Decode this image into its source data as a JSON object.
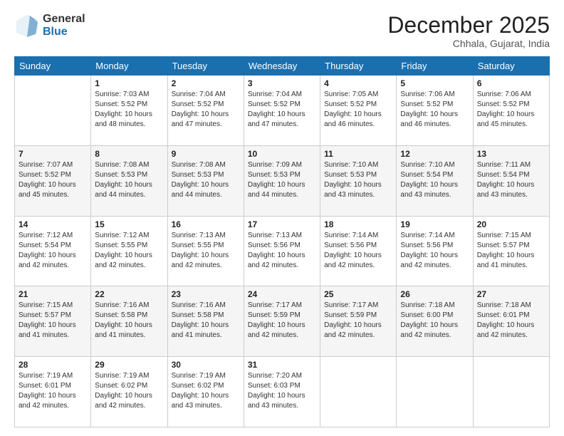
{
  "logo": {
    "general": "General",
    "blue": "Blue"
  },
  "title": "December 2025",
  "location": "Chhala, Gujarat, India",
  "headers": [
    "Sunday",
    "Monday",
    "Tuesday",
    "Wednesday",
    "Thursday",
    "Friday",
    "Saturday"
  ],
  "weeks": [
    [
      {
        "day": "",
        "lines": []
      },
      {
        "day": "1",
        "lines": [
          "Sunrise: 7:03 AM",
          "Sunset: 5:52 PM",
          "Daylight: 10 hours",
          "and 48 minutes."
        ]
      },
      {
        "day": "2",
        "lines": [
          "Sunrise: 7:04 AM",
          "Sunset: 5:52 PM",
          "Daylight: 10 hours",
          "and 47 minutes."
        ]
      },
      {
        "day": "3",
        "lines": [
          "Sunrise: 7:04 AM",
          "Sunset: 5:52 PM",
          "Daylight: 10 hours",
          "and 47 minutes."
        ]
      },
      {
        "day": "4",
        "lines": [
          "Sunrise: 7:05 AM",
          "Sunset: 5:52 PM",
          "Daylight: 10 hours",
          "and 46 minutes."
        ]
      },
      {
        "day": "5",
        "lines": [
          "Sunrise: 7:06 AM",
          "Sunset: 5:52 PM",
          "Daylight: 10 hours",
          "and 46 minutes."
        ]
      },
      {
        "day": "6",
        "lines": [
          "Sunrise: 7:06 AM",
          "Sunset: 5:52 PM",
          "Daylight: 10 hours",
          "and 45 minutes."
        ]
      }
    ],
    [
      {
        "day": "7",
        "lines": [
          "Sunrise: 7:07 AM",
          "Sunset: 5:52 PM",
          "Daylight: 10 hours",
          "and 45 minutes."
        ]
      },
      {
        "day": "8",
        "lines": [
          "Sunrise: 7:08 AM",
          "Sunset: 5:53 PM",
          "Daylight: 10 hours",
          "and 44 minutes."
        ]
      },
      {
        "day": "9",
        "lines": [
          "Sunrise: 7:08 AM",
          "Sunset: 5:53 PM",
          "Daylight: 10 hours",
          "and 44 minutes."
        ]
      },
      {
        "day": "10",
        "lines": [
          "Sunrise: 7:09 AM",
          "Sunset: 5:53 PM",
          "Daylight: 10 hours",
          "and 44 minutes."
        ]
      },
      {
        "day": "11",
        "lines": [
          "Sunrise: 7:10 AM",
          "Sunset: 5:53 PM",
          "Daylight: 10 hours",
          "and 43 minutes."
        ]
      },
      {
        "day": "12",
        "lines": [
          "Sunrise: 7:10 AM",
          "Sunset: 5:54 PM",
          "Daylight: 10 hours",
          "and 43 minutes."
        ]
      },
      {
        "day": "13",
        "lines": [
          "Sunrise: 7:11 AM",
          "Sunset: 5:54 PM",
          "Daylight: 10 hours",
          "and 43 minutes."
        ]
      }
    ],
    [
      {
        "day": "14",
        "lines": [
          "Sunrise: 7:12 AM",
          "Sunset: 5:54 PM",
          "Daylight: 10 hours",
          "and 42 minutes."
        ]
      },
      {
        "day": "15",
        "lines": [
          "Sunrise: 7:12 AM",
          "Sunset: 5:55 PM",
          "Daylight: 10 hours",
          "and 42 minutes."
        ]
      },
      {
        "day": "16",
        "lines": [
          "Sunrise: 7:13 AM",
          "Sunset: 5:55 PM",
          "Daylight: 10 hours",
          "and 42 minutes."
        ]
      },
      {
        "day": "17",
        "lines": [
          "Sunrise: 7:13 AM",
          "Sunset: 5:56 PM",
          "Daylight: 10 hours",
          "and 42 minutes."
        ]
      },
      {
        "day": "18",
        "lines": [
          "Sunrise: 7:14 AM",
          "Sunset: 5:56 PM",
          "Daylight: 10 hours",
          "and 42 minutes."
        ]
      },
      {
        "day": "19",
        "lines": [
          "Sunrise: 7:14 AM",
          "Sunset: 5:56 PM",
          "Daylight: 10 hours",
          "and 42 minutes."
        ]
      },
      {
        "day": "20",
        "lines": [
          "Sunrise: 7:15 AM",
          "Sunset: 5:57 PM",
          "Daylight: 10 hours",
          "and 41 minutes."
        ]
      }
    ],
    [
      {
        "day": "21",
        "lines": [
          "Sunrise: 7:15 AM",
          "Sunset: 5:57 PM",
          "Daylight: 10 hours",
          "and 41 minutes."
        ]
      },
      {
        "day": "22",
        "lines": [
          "Sunrise: 7:16 AM",
          "Sunset: 5:58 PM",
          "Daylight: 10 hours",
          "and 41 minutes."
        ]
      },
      {
        "day": "23",
        "lines": [
          "Sunrise: 7:16 AM",
          "Sunset: 5:58 PM",
          "Daylight: 10 hours",
          "and 41 minutes."
        ]
      },
      {
        "day": "24",
        "lines": [
          "Sunrise: 7:17 AM",
          "Sunset: 5:59 PM",
          "Daylight: 10 hours",
          "and 42 minutes."
        ]
      },
      {
        "day": "25",
        "lines": [
          "Sunrise: 7:17 AM",
          "Sunset: 5:59 PM",
          "Daylight: 10 hours",
          "and 42 minutes."
        ]
      },
      {
        "day": "26",
        "lines": [
          "Sunrise: 7:18 AM",
          "Sunset: 6:00 PM",
          "Daylight: 10 hours",
          "and 42 minutes."
        ]
      },
      {
        "day": "27",
        "lines": [
          "Sunrise: 7:18 AM",
          "Sunset: 6:01 PM",
          "Daylight: 10 hours",
          "and 42 minutes."
        ]
      }
    ],
    [
      {
        "day": "28",
        "lines": [
          "Sunrise: 7:19 AM",
          "Sunset: 6:01 PM",
          "Daylight: 10 hours",
          "and 42 minutes."
        ]
      },
      {
        "day": "29",
        "lines": [
          "Sunrise: 7:19 AM",
          "Sunset: 6:02 PM",
          "Daylight: 10 hours",
          "and 42 minutes."
        ]
      },
      {
        "day": "30",
        "lines": [
          "Sunrise: 7:19 AM",
          "Sunset: 6:02 PM",
          "Daylight: 10 hours",
          "and 43 minutes."
        ]
      },
      {
        "day": "31",
        "lines": [
          "Sunrise: 7:20 AM",
          "Sunset: 6:03 PM",
          "Daylight: 10 hours",
          "and 43 minutes."
        ]
      },
      {
        "day": "",
        "lines": []
      },
      {
        "day": "",
        "lines": []
      },
      {
        "day": "",
        "lines": []
      }
    ]
  ]
}
